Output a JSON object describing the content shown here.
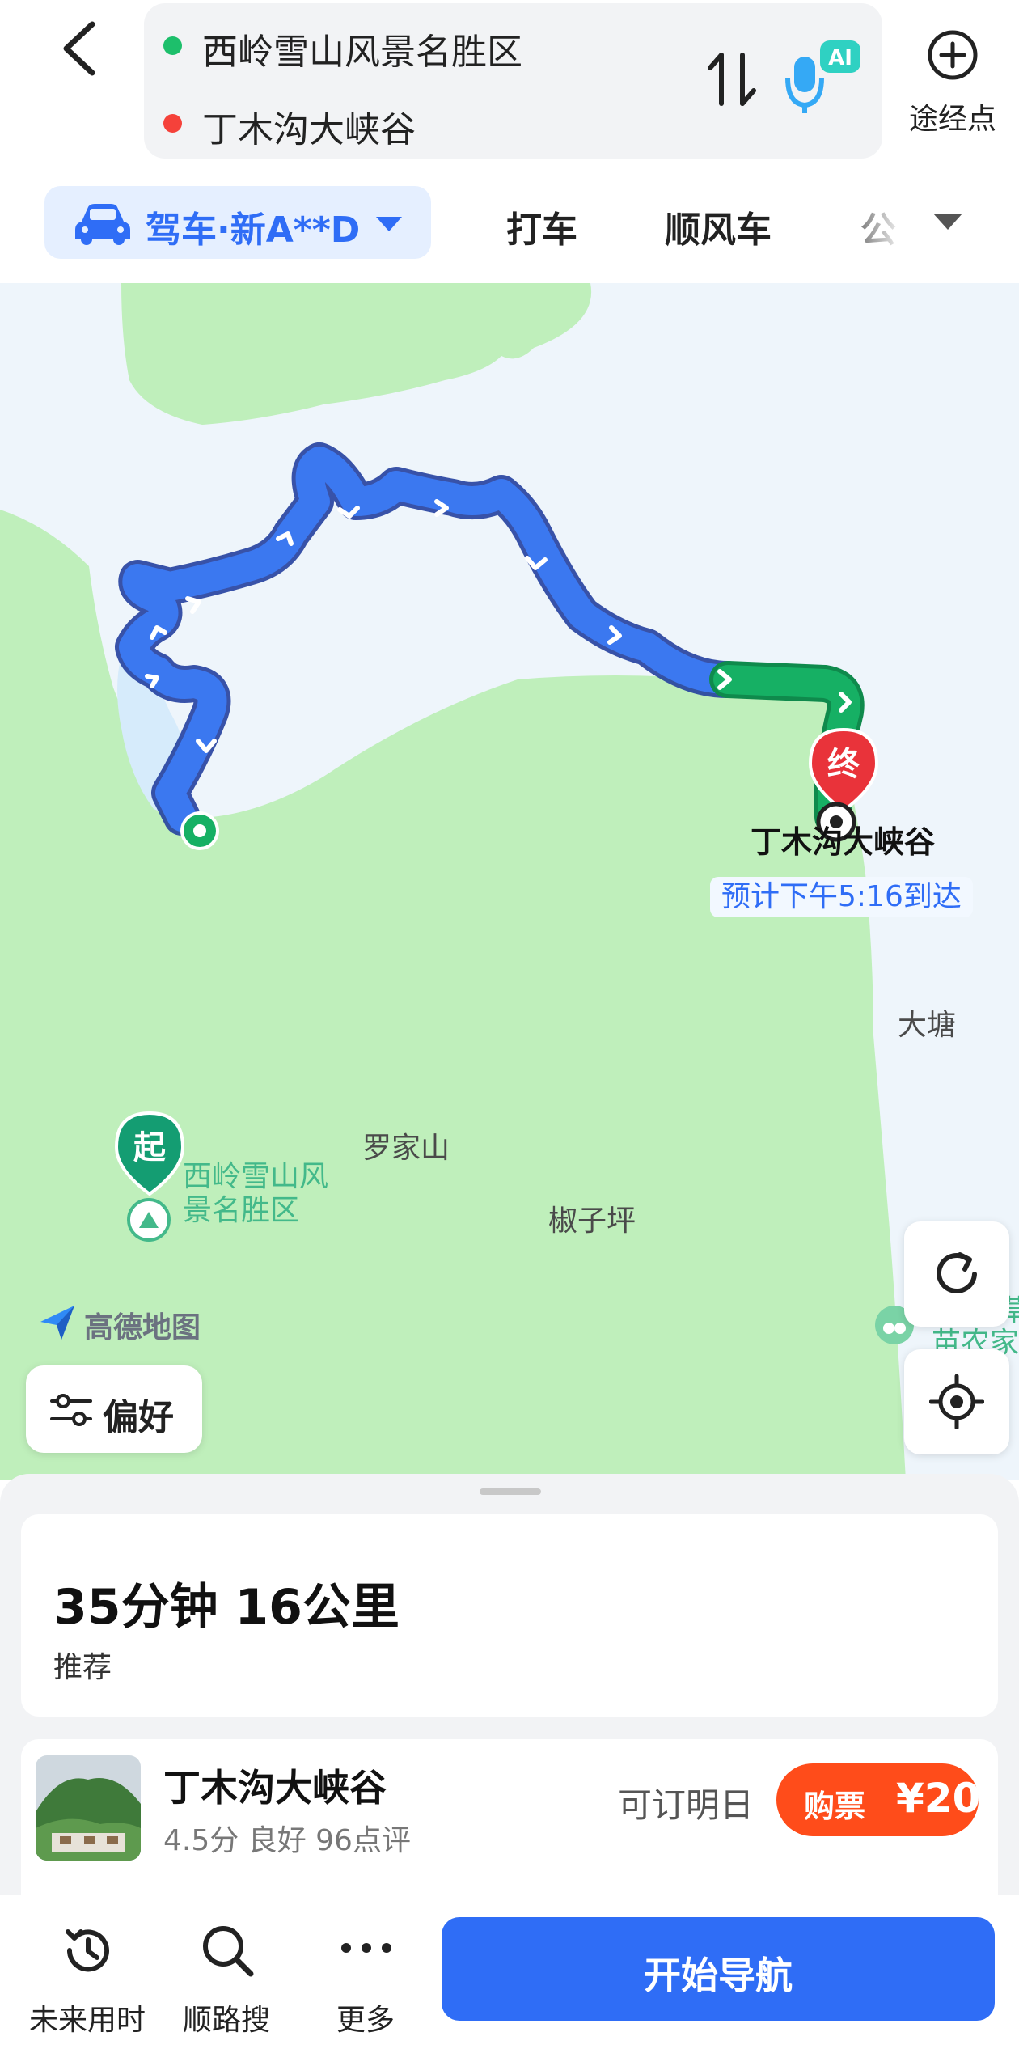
{
  "header": {
    "origin": "西岭雪山风景名胜区",
    "destination": "丁木沟大峡谷",
    "origin_dot_color": "#1dbf6b",
    "destination_dot_color": "#f5413a",
    "waypoint_label": "途经点",
    "ai_badge": "AI"
  },
  "modes": {
    "active": "驾车·新A**D",
    "tabs": [
      "打车",
      "顺风车",
      "公"
    ]
  },
  "map": {
    "destination_pin": "终",
    "destination_name": "丁木沟大峡谷",
    "eta_text": "预计下午5:16到达",
    "start_pin": "起",
    "start_name_line1": "西岭雪山风",
    "start_name_line2": "景名胜区",
    "place_labels": [
      "大塘",
      "罗家山",
      "椒子坪"
    ],
    "partial_poi_line1": "草",
    "partial_poi_line2": "苗农家",
    "brand": "高德地图",
    "preference_button": "偏好",
    "route_color": "#3b78f0",
    "route_end_color": "#16b064"
  },
  "summary": {
    "time_distance": "35分钟  16公里",
    "tag": "推荐"
  },
  "poi": {
    "name": "丁木沟大峡谷",
    "meta": "4.5分 良好 96点评",
    "booking_note": "可订明日",
    "buy_label": "购票",
    "price": "¥20"
  },
  "bottom_bar": {
    "tools": [
      "未来用时",
      "顺路搜",
      "更多"
    ],
    "start_button": "开始导航"
  }
}
